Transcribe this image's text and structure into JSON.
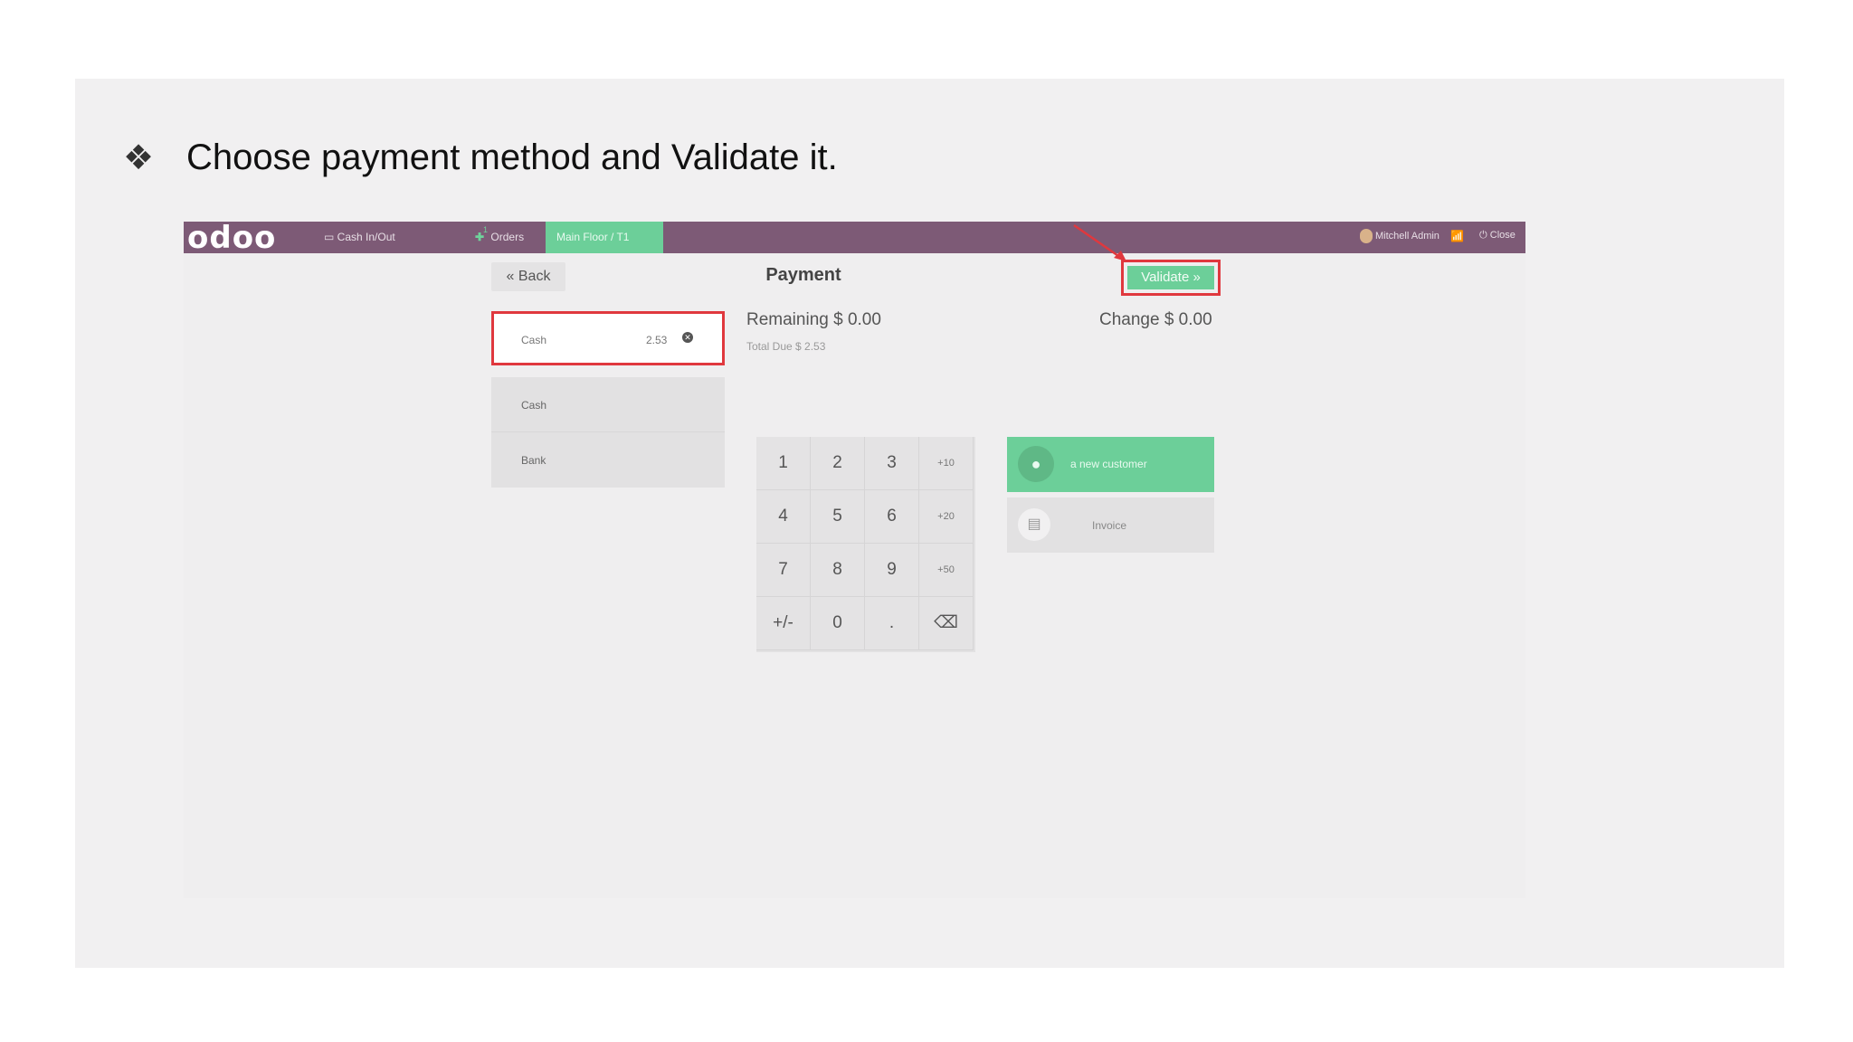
{
  "slide": {
    "bullet": "❖",
    "heading": "Choose payment method and Validate it."
  },
  "topbar": {
    "logo": "odoo",
    "cash_in_out": "Cash In/Out",
    "orders_label": "Orders",
    "orders_badge": "1",
    "floor_tab": "Main Floor / T1",
    "user_name": "Mitchell Admin",
    "close_label": "Close"
  },
  "payment": {
    "back_label": "« Back",
    "title": "Payment",
    "validate_label": "Validate »",
    "line": {
      "method": "Cash",
      "amount": "2.53"
    },
    "methods": [
      "Cash",
      "Bank"
    ],
    "remaining": "Remaining $ 0.00",
    "total_due": "Total Due $ 2.53",
    "change": "Change $ 0.00",
    "customer_label": "a new customer",
    "invoice_label": "Invoice"
  },
  "numpad": {
    "keys": [
      "1",
      "2",
      "3",
      "+10",
      "4",
      "5",
      "6",
      "+20",
      "7",
      "8",
      "9",
      "+50",
      "+/-",
      "0",
      ".",
      "⌫"
    ]
  },
  "colors": {
    "topbar": "#7d5a76",
    "accent_green": "#6ccf99",
    "highlight_red": "#e0383e"
  }
}
